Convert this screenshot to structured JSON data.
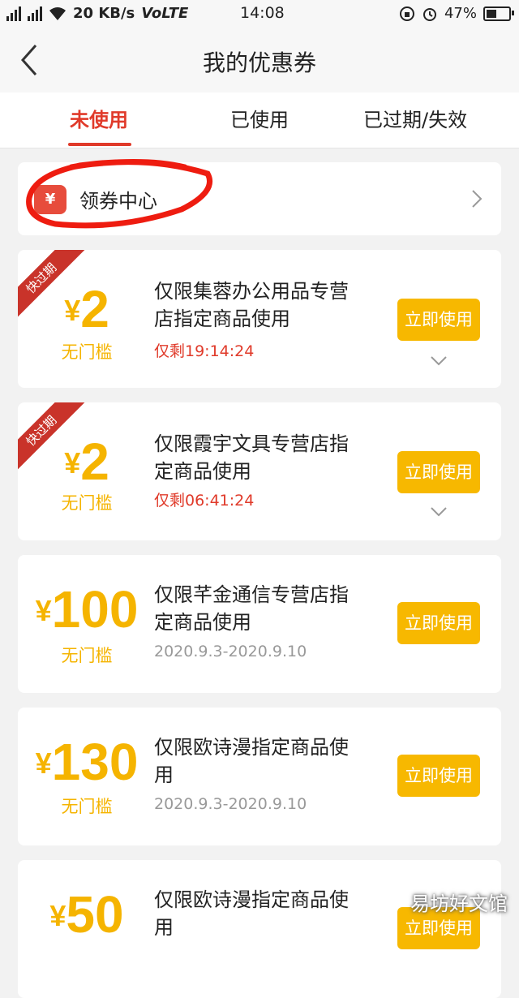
{
  "status_bar": {
    "net_speed": "20 KB/s",
    "volte": "VoLTE",
    "time": "14:08",
    "battery": "47%",
    "battery_level": 0.47
  },
  "nav": {
    "title": "我的优惠券"
  },
  "tabs": [
    {
      "label": "未使用"
    },
    {
      "label": "已使用"
    },
    {
      "label": "已过期/失效"
    }
  ],
  "coupon_center": {
    "icon_text": "¥",
    "label": "领券中心"
  },
  "coupons": [
    {
      "ribbon": "快过期",
      "currency": "¥",
      "amount": "2",
      "threshold": "无门槛",
      "desc_line1": "仅限集蓉办公用品专营",
      "desc_line2": "店指定商品使用",
      "sub": "仅剩19:14:24",
      "button": "立即使用"
    },
    {
      "ribbon": "快过期",
      "currency": "¥",
      "amount": "2",
      "threshold": "无门槛",
      "desc_line1": "仅限霞宇文具专营店指",
      "desc_line2": "定商品使用",
      "sub": "仅剩06:41:24",
      "button": "立即使用"
    },
    {
      "currency": "¥",
      "amount": "100",
      "threshold": "无门槛",
      "desc_line1": "仅限芊金通信专营店指",
      "desc_line2": "定商品使用",
      "sub": "2020.9.3-2020.9.10",
      "button": "立即使用"
    },
    {
      "currency": "¥",
      "amount": "130",
      "threshold": "无门槛",
      "desc_line1": "仅限欧诗漫指定商品使",
      "desc_line2": "用",
      "sub": "2020.9.3-2020.9.10",
      "button": "立即使用"
    },
    {
      "currency": "¥",
      "amount": "50",
      "desc_line1": "仅限欧诗漫指定商品使",
      "desc_line2": "用",
      "button": "立即使用"
    }
  ],
  "watermark": "易坊好文馆",
  "colors": {
    "accent_red": "#e03a2a",
    "coupon_yellow": "#f5b400",
    "button_yellow": "#f7b800"
  }
}
